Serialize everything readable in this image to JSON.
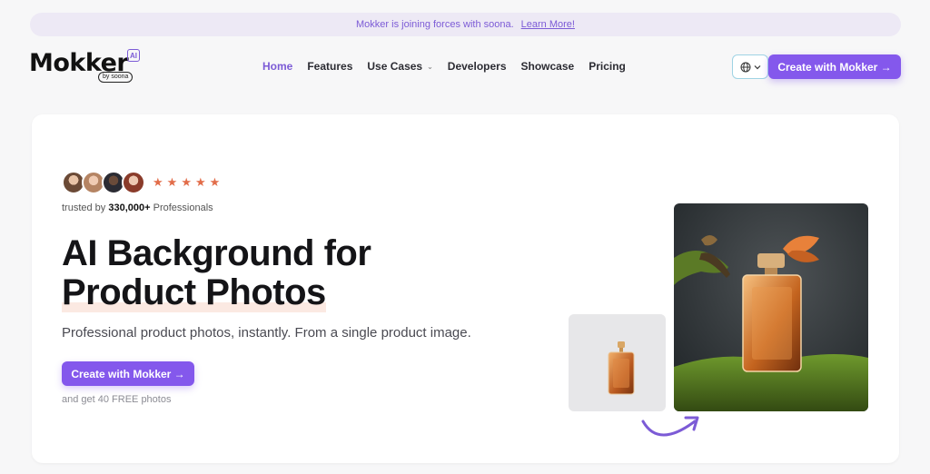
{
  "announcement": {
    "text": "Mokker is joining forces with soona.",
    "link": "Learn More!"
  },
  "logo": {
    "wordmark": "Mokker",
    "badge": "AI",
    "byline": "by soona"
  },
  "nav": {
    "items": [
      {
        "label": "Home",
        "active": true
      },
      {
        "label": "Features"
      },
      {
        "label": "Use Cases",
        "has_dropdown": true
      },
      {
        "label": "Developers"
      },
      {
        "label": "Showcase"
      },
      {
        "label": "Pricing"
      }
    ]
  },
  "header": {
    "language_icon": "globe-icon",
    "cta_label": "Create with Mokker →"
  },
  "hero": {
    "rating_stars": 5,
    "trusted_prefix": "trusted by",
    "trusted_count": "330,000+",
    "trusted_suffix": "Professionals",
    "headline_line1": "AI Background for",
    "headline_line2": "Product Photos",
    "subheadline": "Professional product photos, instantly. From a single product image.",
    "cta_label": "Create with Mokker →",
    "free_note": "and get 40 FREE photos"
  },
  "colors": {
    "accent": "#8458ec",
    "announce_bg": "#ede9f5",
    "star": "#e26d4a"
  }
}
